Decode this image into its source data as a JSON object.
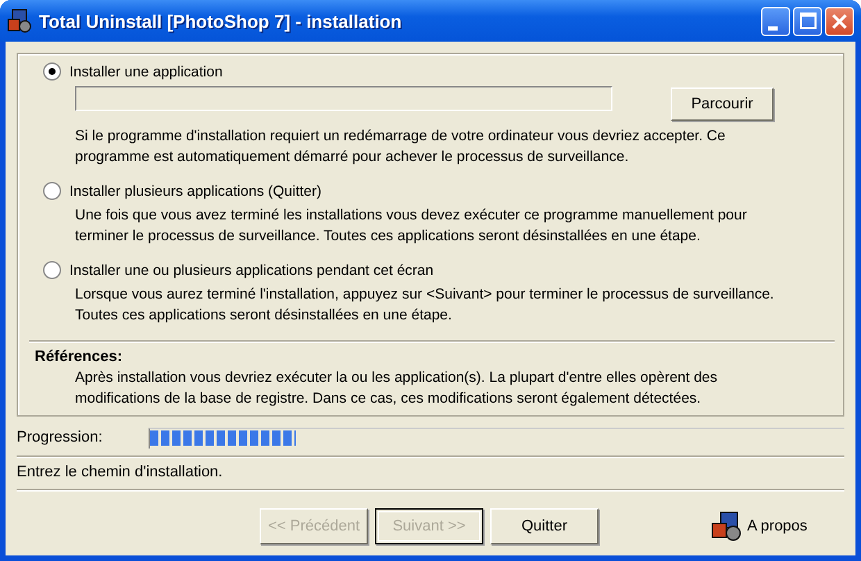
{
  "window": {
    "title": "Total Uninstall [PhotoShop 7] - installation"
  },
  "options": [
    {
      "label": "Installer une application",
      "selected": true,
      "browse_button": "Parcourir",
      "description": "Si le programme d'installation requiert un redémarrage de votre ordinateur vous devriez accepter. Ce programme est automatiquement démarré pour achever le processus de surveillance."
    },
    {
      "label": "Installer plusieurs applications (Quitter)",
      "selected": false,
      "description": "Une fois que vous avez terminé les installations vous devez exécuter ce programme manuellement pour terminer le processus de surveillance. Toutes ces applications seront désinstallées en une étape."
    },
    {
      "label": "Installer une ou plusieurs applications pendant cet écran",
      "selected": false,
      "description": "Lorsque vous aurez terminé l'installation, appuyez sur <Suivant> pour terminer le processus de surveillance. Toutes ces applications seront désinstallées en une étape."
    }
  ],
  "references": {
    "heading": "Références:",
    "text": "Après installation vous devriez exécuter la ou les application(s). La plupart d'entre elles opèrent des modifications de la base de registre. Dans ce cas, ces modifications seront également détectées."
  },
  "progress": {
    "label": "Progression:",
    "level": 0.21
  },
  "status": "Entrez le chemin d'installation.",
  "buttons": [
    {
      "label": "<< Précédent",
      "disabled": true,
      "default": false
    },
    {
      "label": "Suivant >>",
      "disabled": true,
      "default": true
    },
    {
      "label": "Quitter",
      "disabled": false,
      "default": false
    }
  ],
  "about": "A propos"
}
